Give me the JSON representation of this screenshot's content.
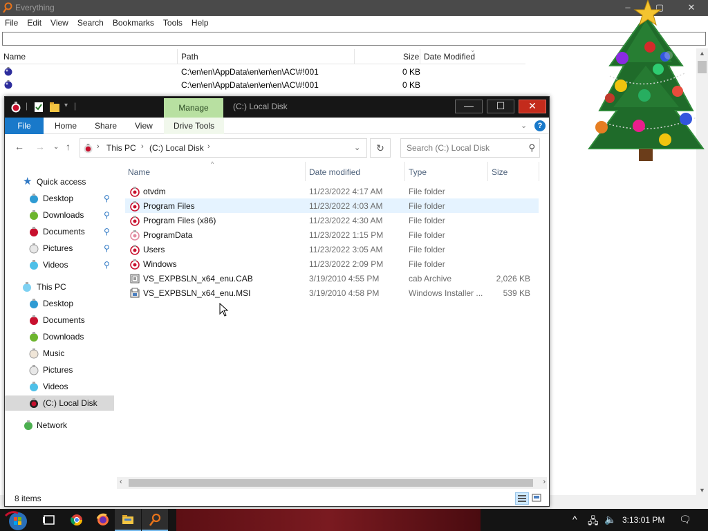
{
  "everything": {
    "title": "Everything",
    "menu": [
      "File",
      "Edit",
      "View",
      "Search",
      "Bookmarks",
      "Tools",
      "Help"
    ],
    "search_value": "",
    "columns": {
      "name": "Name",
      "path": "Path",
      "size": "Size",
      "date_modified": "Date Modified"
    },
    "rows": [
      {
        "path": "C:\\en\\en\\AppData\\en\\en\\en\\AC\\#!001",
        "size": "0 KB"
      },
      {
        "path": "C:\\en\\en\\AppData\\en\\en\\en\\AC\\#!001",
        "size": "0 KB"
      }
    ]
  },
  "explorer": {
    "title": "(C:) Local Disk",
    "context_tab": "Manage",
    "ribbon_tabs": [
      "File",
      "Home",
      "Share",
      "View",
      "Drive Tools"
    ],
    "breadcrumb": [
      "This PC",
      "(C:) Local Disk"
    ],
    "search_placeholder": "Search (C:) Local Disk",
    "columns": {
      "name": "Name",
      "date": "Date modified",
      "type": "Type",
      "size": "Size"
    },
    "nav": {
      "quick_access": "Quick access",
      "quick_items": [
        "Desktop",
        "Downloads",
        "Documents",
        "Pictures",
        "Videos"
      ],
      "this_pc": "This PC",
      "pc_items": [
        "Desktop",
        "Documents",
        "Downloads",
        "Music",
        "Pictures",
        "Videos",
        "(C:) Local Disk"
      ],
      "network": "Network"
    },
    "files": [
      {
        "name": "otvdm",
        "date": "11/23/2022 4:17 AM",
        "type": "File folder",
        "size": ""
      },
      {
        "name": "Program Files",
        "date": "11/23/2022 4:03 AM",
        "type": "File folder",
        "size": ""
      },
      {
        "name": "Program Files (x86)",
        "date": "11/23/2022 4:30 AM",
        "type": "File folder",
        "size": ""
      },
      {
        "name": "ProgramData",
        "date": "11/23/2022 1:15 PM",
        "type": "File folder",
        "size": ""
      },
      {
        "name": "Users",
        "date": "11/23/2022 3:05 AM",
        "type": "File folder",
        "size": ""
      },
      {
        "name": "Windows",
        "date": "11/23/2022 2:09 PM",
        "type": "File folder",
        "size": ""
      },
      {
        "name": "VS_EXPBSLN_x64_enu.CAB",
        "date": "3/19/2010 4:55 PM",
        "type": "cab Archive",
        "size": "2,026 KB"
      },
      {
        "name": "VS_EXPBSLN_x64_enu.MSI",
        "date": "3/19/2010 4:58 PM",
        "type": "Windows Installer ...",
        "size": "539 KB"
      }
    ],
    "status": "8 items"
  },
  "taskbar": {
    "time": "3:13:01 PM",
    "apps": [
      "start-icon",
      "task-view-icon",
      "chrome-icon",
      "firefox-icon",
      "file-explorer-icon",
      "everything-icon"
    ]
  },
  "colors": {
    "ribbon_file": "#1979ca",
    "manage_tab": "#b8e0a1",
    "close_button": "#c42b1c",
    "hover_row": "#e5f3ff"
  }
}
